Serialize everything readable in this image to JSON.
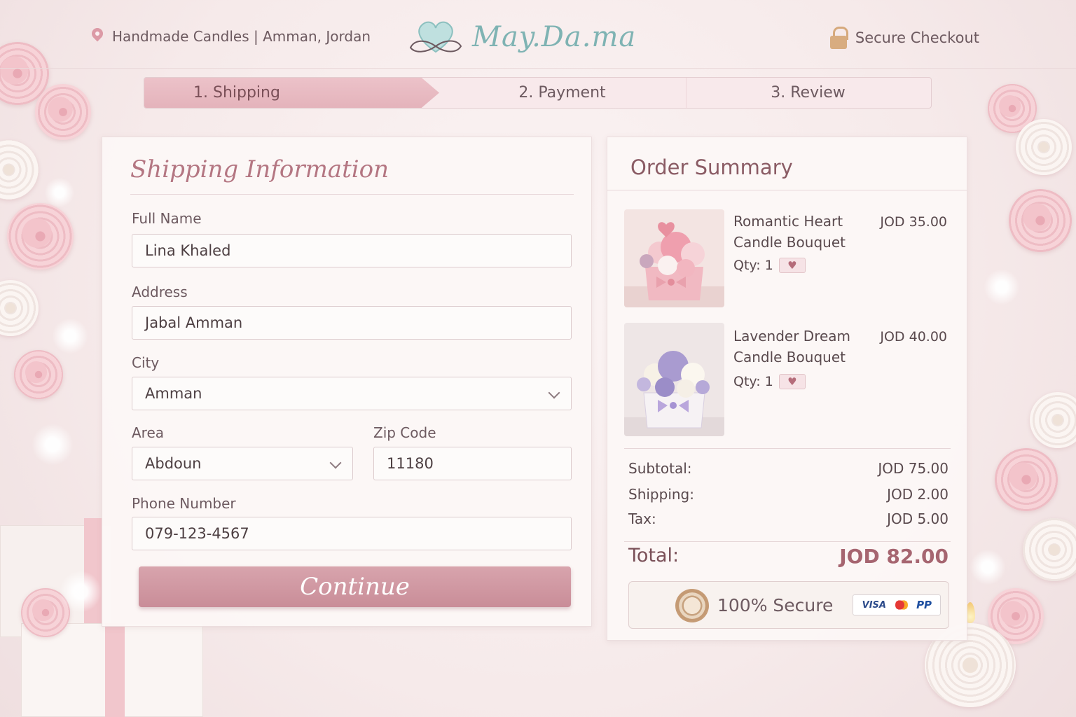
{
  "header": {
    "location": "Handmade Candles | Amman, Jordan",
    "brand": "May.Da.ma",
    "secure_label": "Secure Checkout"
  },
  "stepper": {
    "steps": [
      {
        "label": "1.   Shipping",
        "active": true
      },
      {
        "label": "2. Payment",
        "active": false
      },
      {
        "label": "3. Review",
        "active": false
      }
    ]
  },
  "shipping": {
    "title": "Shipping Information",
    "full_name": {
      "label": "Full Name",
      "value": "Lina Khaled"
    },
    "address": {
      "label": "Address",
      "value": "Jabal Amman"
    },
    "city": {
      "label": "City",
      "value": "Amman"
    },
    "area": {
      "label": "Area",
      "value": "Abdoun"
    },
    "zip": {
      "label": "Zip Code",
      "value": "11180"
    },
    "phone": {
      "label": "Phone Number",
      "value": "079-123-4567"
    },
    "continue_label": "Continue"
  },
  "summary": {
    "title": "Order Summary",
    "items": [
      {
        "name": "Romantic Heart Candle Bouquet",
        "price": "JOD 35.00",
        "qty": "Qty: 1"
      },
      {
        "name": "Lavender Dream Candle Bouquet",
        "price": "JOD 40.00",
        "qty": "Qty: 1"
      }
    ],
    "subtotal": {
      "label": "Subtotal:",
      "value": "JOD 75.00"
    },
    "shipping": {
      "label": "Shipping:",
      "value": "JOD 2.00"
    },
    "tax": {
      "label": "Tax:",
      "value": "JOD 5.00"
    },
    "total": {
      "label": "Total:",
      "value": "JOD 82.00"
    },
    "secure_badge": "100% Secure",
    "payment_logos": {
      "visa": "VISA",
      "paypal": "PP"
    }
  },
  "colors": {
    "accent": "#c98d98",
    "brand_teal": "#7fb3b3",
    "background": "#f6eaea"
  }
}
